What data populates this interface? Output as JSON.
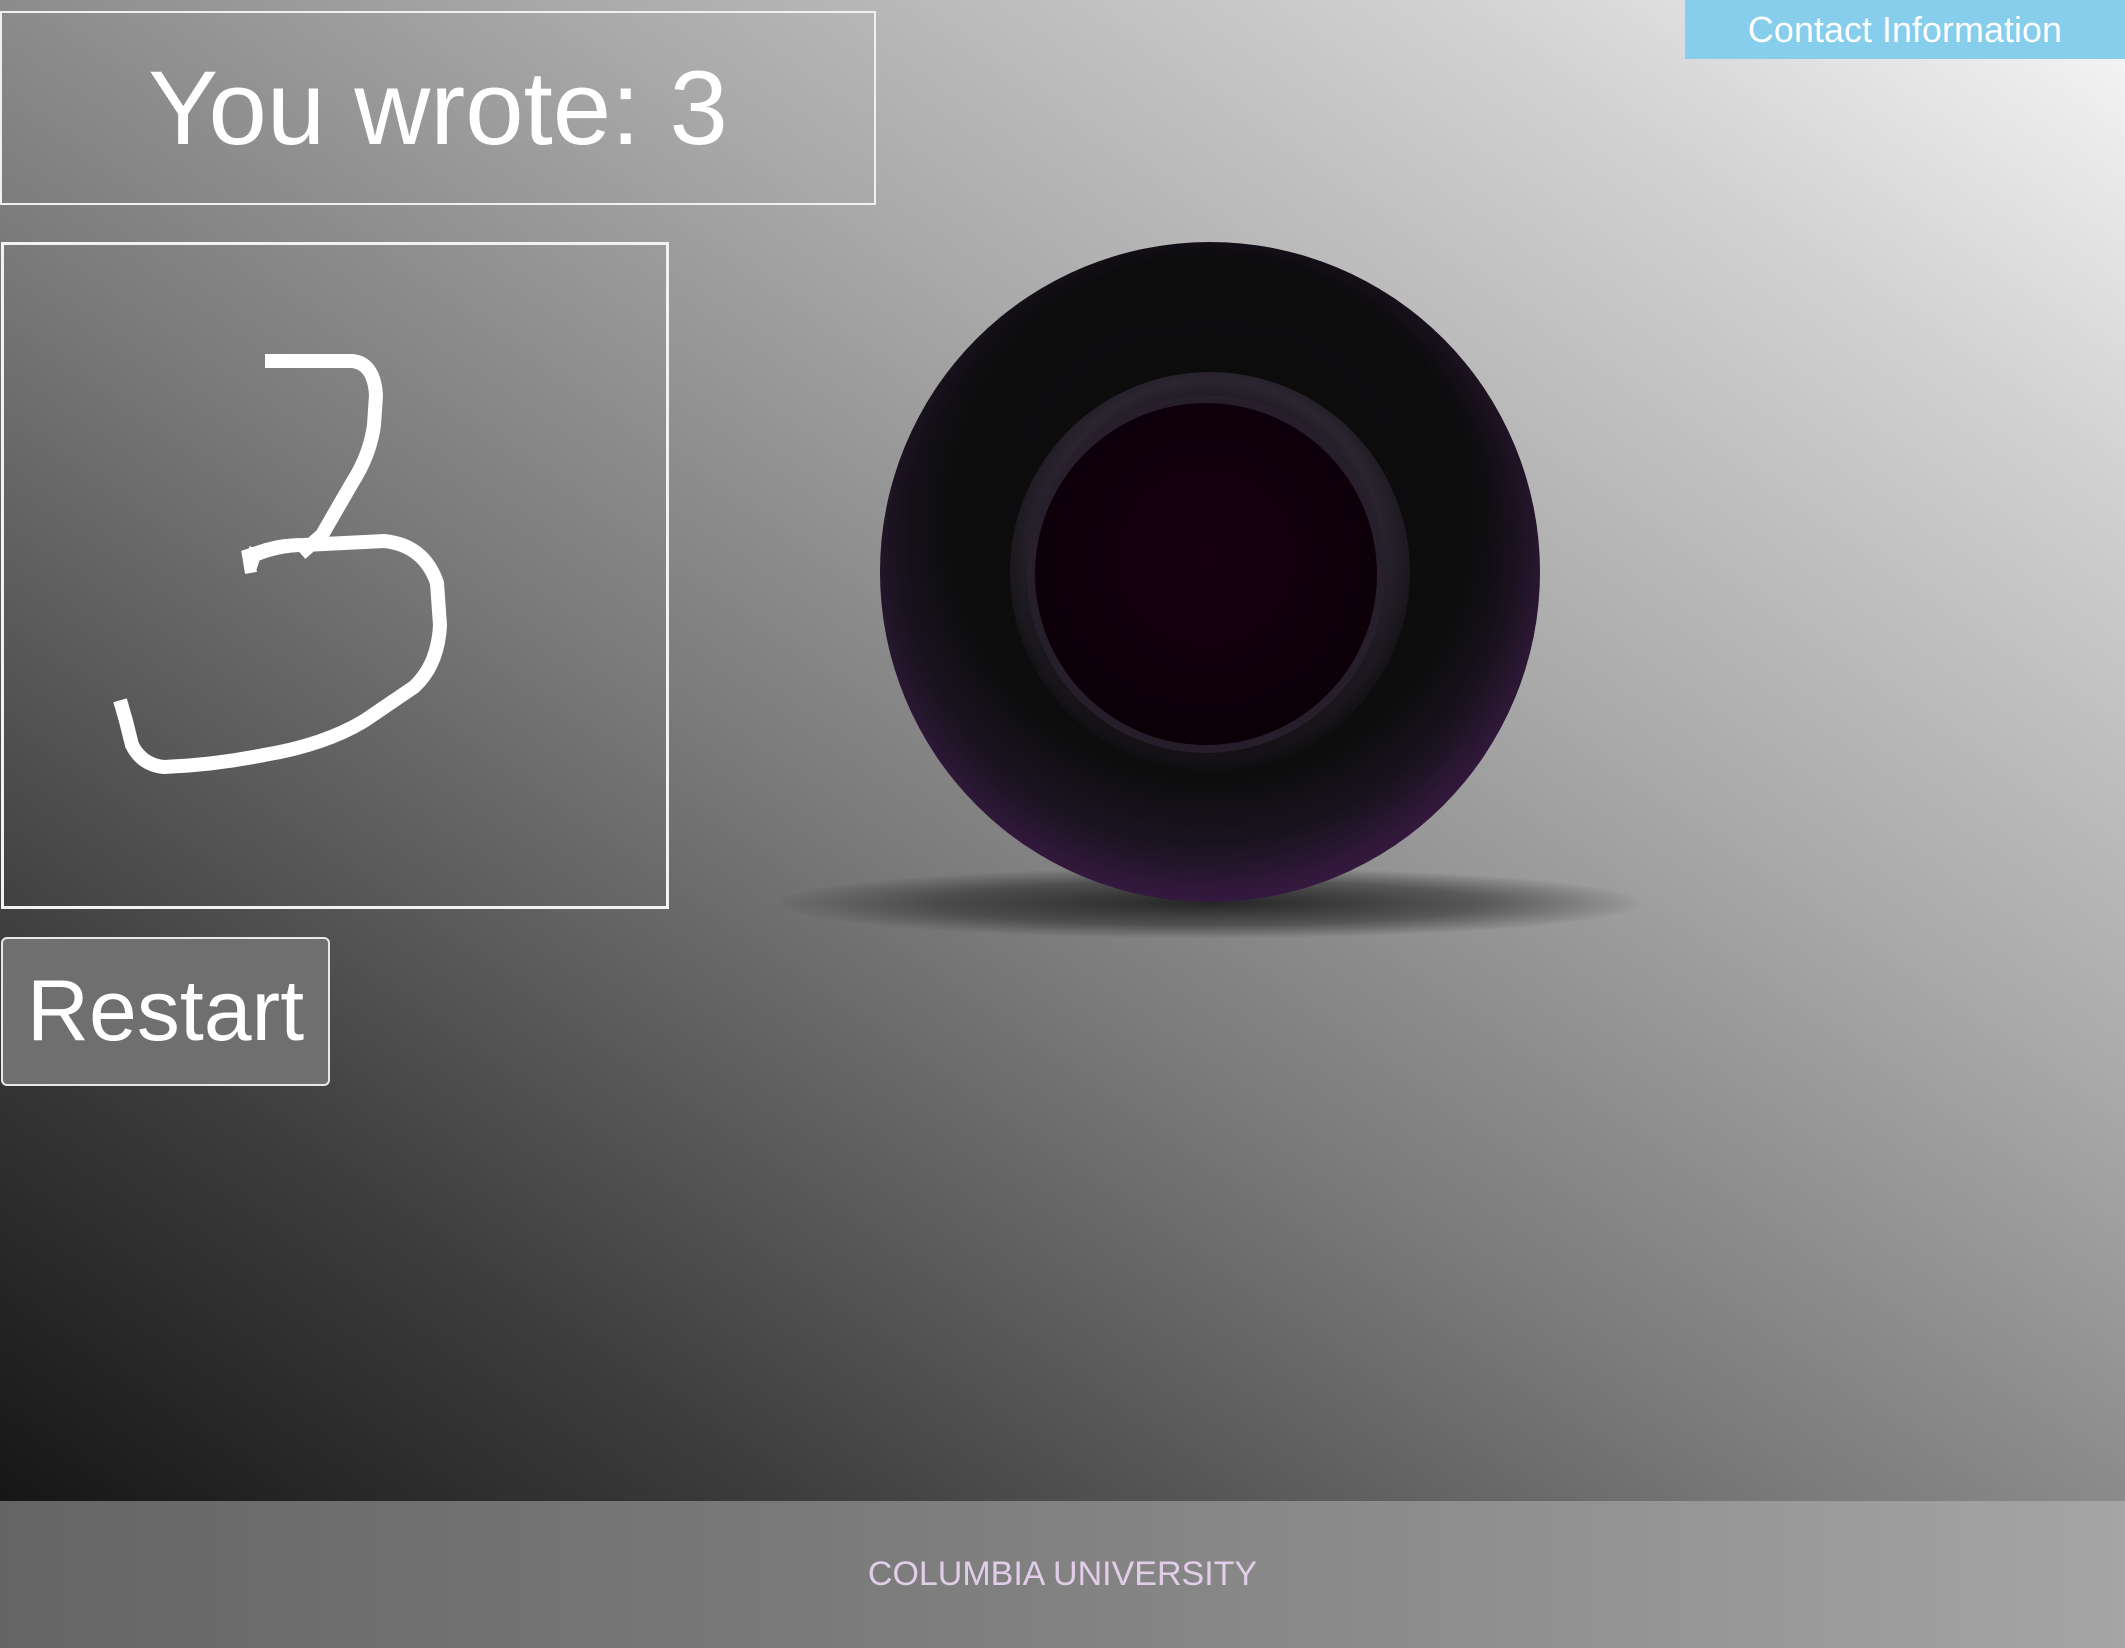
{
  "result": {
    "text": "You wrote: 3"
  },
  "header": {
    "contact_label": "Contact Information"
  },
  "controls": {
    "restart_label": "Restart"
  },
  "footer": {
    "text": "COLUMBIA UNIVERSITY"
  },
  "icons": {
    "magic_ball": "magic-8-ball-icon"
  },
  "colors": {
    "contact_button": "#86ceeb",
    "footer_text": "#e2cde8",
    "ball_rim": "#4a2256",
    "stroke": "#ffffff"
  }
}
